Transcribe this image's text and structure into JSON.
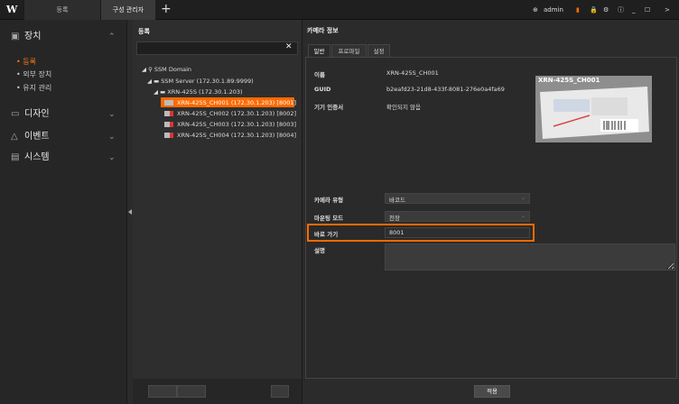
{
  "app": {
    "logo": "W",
    "tabs": [
      "등록",
      "구성 관리자"
    ],
    "user": "admin"
  },
  "sidebar": {
    "items": [
      {
        "label": "장치",
        "icon": "device-icon",
        "expanded": true
      },
      {
        "label": "디자인",
        "icon": "design-icon"
      },
      {
        "label": "이벤트",
        "icon": "bell-icon"
      },
      {
        "label": "시스템",
        "icon": "system-icon"
      }
    ],
    "sub_items": [
      "등록",
      "외부 장치",
      "유지 관리"
    ]
  },
  "register": {
    "title": "등록",
    "search_placeholder": "",
    "tree": [
      {
        "label": "SSM Domain",
        "level": 0
      },
      {
        "label": "SSM Server (172.30.1.89:9999)",
        "level": 1
      },
      {
        "label": "XRN-425S (172.30.1.203)",
        "level": 2
      },
      {
        "label": "XRN-425S_CH001 (172.30.1.203) [8001]",
        "level": 3,
        "selected": true
      },
      {
        "label": "XRN-425S_CH002 (172.30.1.203) [8002]",
        "level": 3
      },
      {
        "label": "XRN-425S_CH003 (172.30.1.203) [8003]",
        "level": 3
      },
      {
        "label": "XRN-425S_CH004 (172.30.1.203) [8004]",
        "level": 3
      }
    ]
  },
  "camera_info": {
    "title": "카메라 정보",
    "tabs": [
      "일반",
      "프로파일",
      "설정"
    ],
    "name_label": "이름",
    "name_value": "XRN-425S_CH001",
    "guid_label": "GUID",
    "guid_value": "b2eafd23-21d8-433f-8081-276e0a4fa69",
    "cert_label": "기기 인증서",
    "cert_value": "확인되지 않음",
    "thumb_caption": "XRN-425S_CH001",
    "type_label": "카메라 유형",
    "type_value": "바코드",
    "mount_label": "마운팅 모드",
    "mount_value": "천장",
    "shortcut_label": "바로 가기",
    "shortcut_value": "8001",
    "desc_label": "설명",
    "apply_label": "적용"
  },
  "colors": {
    "accent": "#ff6a00",
    "bg": "#2b2b2b"
  }
}
